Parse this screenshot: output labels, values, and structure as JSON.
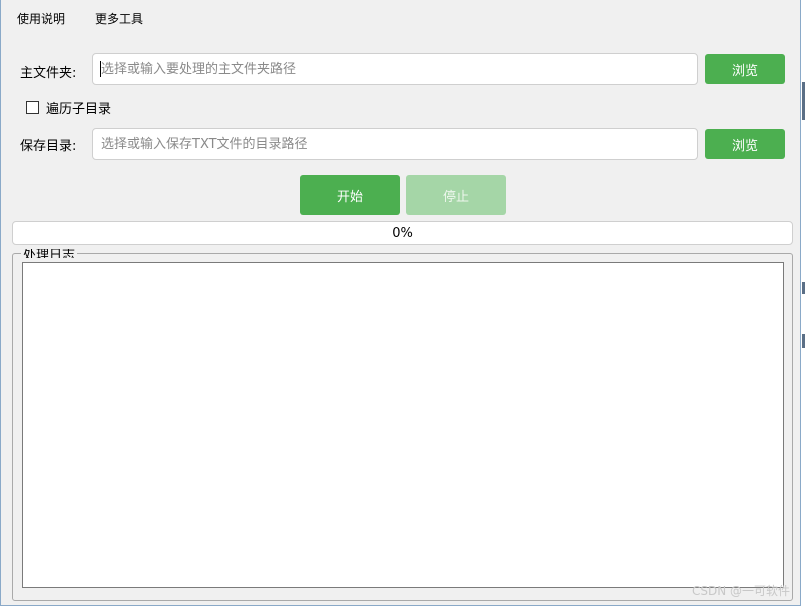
{
  "menu": {
    "help": "使用说明",
    "more_tools": "更多工具"
  },
  "main_folder": {
    "label": "主文件夹:",
    "placeholder": "选择或输入要处理的主文件夹路径",
    "browse": "浏览"
  },
  "recurse_checkbox": {
    "label": "遍历子目录",
    "checked": false
  },
  "save_dir": {
    "label": "保存目录:",
    "placeholder": "选择或输入保存TXT文件的目录路径",
    "browse": "浏览"
  },
  "actions": {
    "start": "开始",
    "stop": "停止"
  },
  "progress": {
    "percent": 0,
    "text": "0%"
  },
  "log": {
    "title": "处理日志",
    "content": ""
  },
  "watermark": "CSDN @一可软件",
  "colors": {
    "accent": "#4caf50",
    "accent_disabled": "#a5d6a7",
    "window_bg": "#f0f0f0"
  }
}
